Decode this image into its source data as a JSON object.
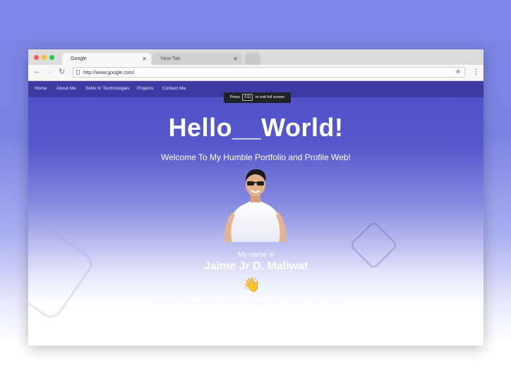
{
  "browser": {
    "tabs": [
      {
        "label": "Google"
      },
      {
        "label": "New Tab"
      }
    ],
    "url": "http://www.google.com/"
  },
  "site": {
    "nav": [
      "Home",
      "About Me",
      "Skills N' Technologies",
      "Projects",
      "Contact Me"
    ],
    "fullscreen_notice": {
      "prefix": "Press",
      "key": "F11",
      "suffix": "to exit full screen"
    },
    "hero": {
      "title": "Hello__World!",
      "subtitle": "Welcome To My Humble Portfolio and Profile Web!",
      "name_intro": "My name is",
      "name": "Jaime Jr D. Maliwat",
      "emoji": "👋",
      "quote": "\"Knowing That Defeat Does Not Mean Failure, But Knowing It As A Stepping Stone\""
    }
  },
  "colors": {
    "nav_bg": "#3e3aa4",
    "hero_top": "#4e4fc6",
    "page_bg": "#7d86e6"
  }
}
